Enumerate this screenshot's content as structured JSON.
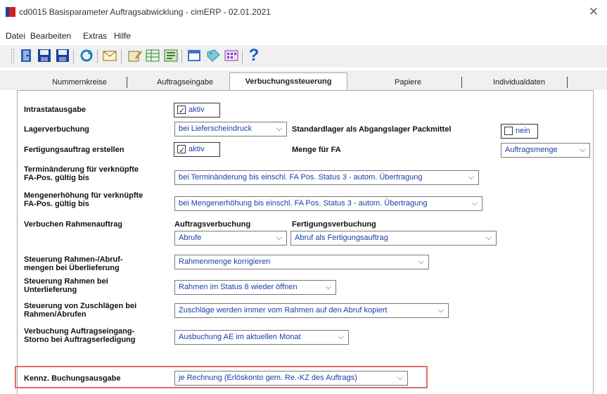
{
  "window": {
    "title": "cd0015 Basisparameter Auftragsabwicklung - cimERP - 02.01.2021",
    "close_glyph": "✕"
  },
  "menu": [
    "Datei",
    "Bearbeiten",
    "Extras",
    "Hilfe"
  ],
  "toolbar_icons": [
    {
      "name": "exit-icon",
      "color": "#2f5fb0"
    },
    {
      "name": "save-icon",
      "color": "#1a3f9a"
    },
    {
      "name": "save-all-icon",
      "color": "#1a3f9a"
    },
    {
      "name": "refresh-icon",
      "color": "#1d7ec2"
    },
    {
      "name": "mail-icon",
      "color": "#e6b33a"
    },
    {
      "name": "edit-icon",
      "color": "#c98d2a"
    },
    {
      "name": "table-icon",
      "color": "#2f8a3a"
    },
    {
      "name": "list-icon",
      "color": "#3b7d2e"
    },
    {
      "name": "window-icon",
      "color": "#3f74c8"
    },
    {
      "name": "tags-icon",
      "color": "#1f8fa8"
    },
    {
      "name": "grid-icon",
      "color": "#8c3ab0"
    },
    {
      "name": "help-icon",
      "color": "#1f53d6"
    }
  ],
  "tabs": [
    "Nummernkreise",
    "Auftragseingabe",
    "Verbuchungssteuerung",
    "Papiere",
    "Individualdaten"
  ],
  "form": {
    "intrastat": {
      "label": "Intrastatausgabe",
      "value": "aktiv"
    },
    "lager": {
      "label": "Lagerverbuchung",
      "value": "bei Lieferscheindruck"
    },
    "standardlager": {
      "label": "Standardlager als Abgangslager Packmittel",
      "value": "nein"
    },
    "fa": {
      "label": "Fertigungsauftrag erstellen",
      "value": "aktiv"
    },
    "menge_fa": {
      "label": "Menge für FA",
      "value": "Auftragsmenge"
    },
    "termin": {
      "label_1": "Terminänderung für verknüpfte",
      "label_2": "FA-Pos. gültig bis",
      "value": "bei Terminänderung bis einschl. FA Pos. Status 3 - autom. Übertragung"
    },
    "mengen": {
      "label_1": "Mengenerhöhung für verknüpfte",
      "label_2": "FA-Pos. gültig bis",
      "value": "bei Mengenerhöhung bis einschl. FA Pos. Status 3 - autom. Übertragung"
    },
    "rahmen": {
      "label": "Verbuchen Rahmenauftrag",
      "col1_label": "Auftragsverbuchung",
      "col1_value": "Abrufe",
      "col2_label": "Fertigungsverbuchung",
      "col2_value": "Abruf als Fertigungsauftrag"
    },
    "ueber": {
      "label_1": "Steuerung Rahmen-/Abruf-",
      "label_2": "mengen bei Überlieferung",
      "value": "Rahmenmenge korrigieren"
    },
    "unter": {
      "label_1": "Steuerung Rahmen bei",
      "label_2": "Unterlieferung",
      "value": "Rahmen im Status 8 wieder öffnen"
    },
    "zuschlag": {
      "label_1": "Steuerung von Zuschlägen bei",
      "label_2": "Rahmen/Abrufen",
      "value": "Zuschläge werden immer vom Rahmen auf den Abruf kopiert"
    },
    "storno": {
      "label_1": "Verbuchung Auftragseingang-",
      "label_2": "Storno bei Auftragserledigung",
      "value": "Ausbuchung AE im aktuellen Monat"
    },
    "kennz": {
      "label": "Kennz. Buchungsausgabe",
      "value": "je Rechnung (Erlöskonto gem. Re.-KZ des Auftrags)"
    }
  },
  "chevron": "⌵"
}
